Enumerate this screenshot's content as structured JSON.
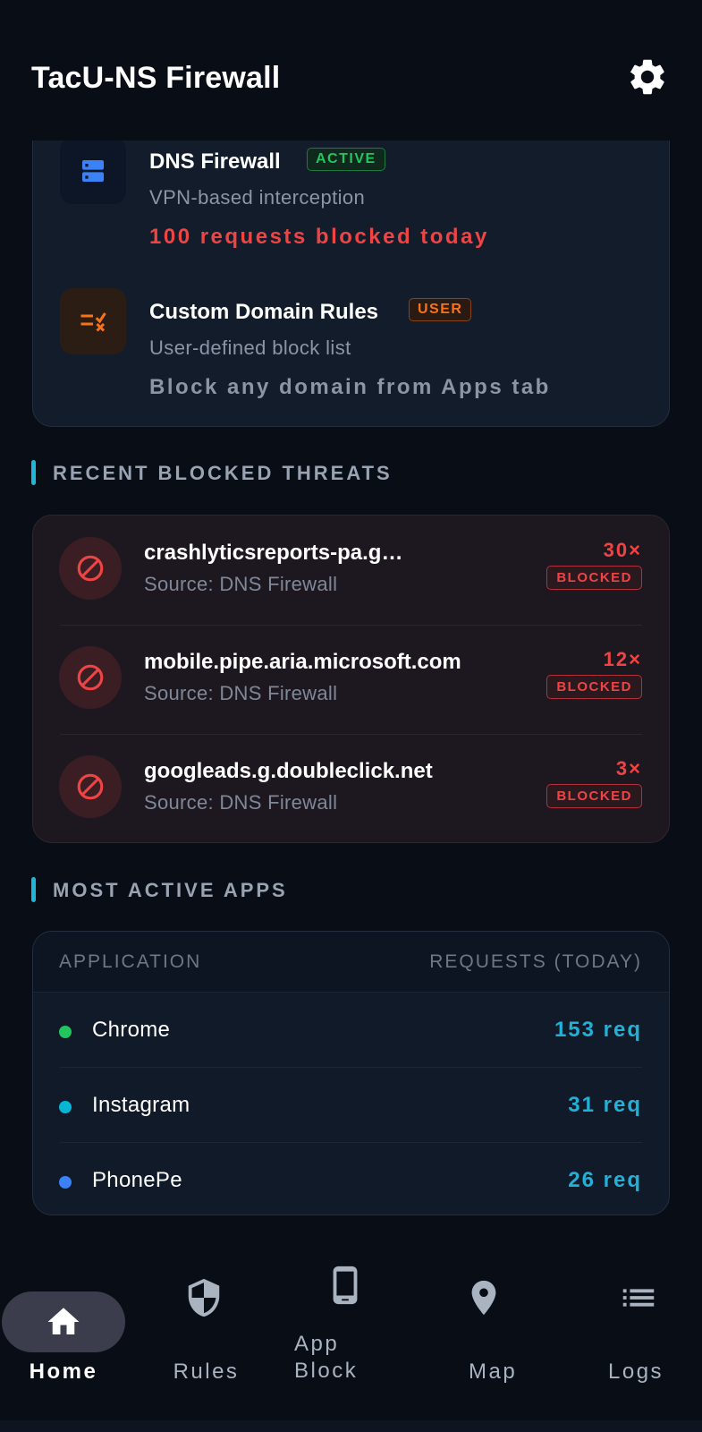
{
  "app": {
    "title": "TacU-NS Firewall"
  },
  "engines": [
    {
      "name": "DNS Firewall",
      "badge": "ACTIVE",
      "description": "VPN-based interception",
      "stat": "100 requests blocked today"
    },
    {
      "name": "Custom Domain Rules",
      "badge": "USER",
      "description": "User-defined block list",
      "stat": "Block any domain from Apps tab"
    }
  ],
  "threats": {
    "section_title": "RECENT BLOCKED THREATS",
    "items": [
      {
        "domain": "crashlyticsreports-pa.googleapis.com",
        "source": "Source: DNS Firewall",
        "count": "30×",
        "status": "BLOCKED"
      },
      {
        "domain": "mobile.pipe.aria.microsoft.com",
        "source": "Source: DNS Firewall",
        "count": "12×",
        "status": "BLOCKED"
      },
      {
        "domain": "googleads.g.doubleclick.net",
        "source": "Source: DNS Firewall",
        "count": "3×",
        "status": "BLOCKED"
      }
    ]
  },
  "apps": {
    "section_title": "MOST ACTIVE APPS",
    "col_application": "APPLICATION",
    "col_requests": "REQUESTS (TODAY)",
    "rows": [
      {
        "name": "Chrome",
        "requests": "153 req",
        "dot_color": "#22c55e"
      },
      {
        "name": "Instagram",
        "requests": "31 req",
        "dot_color": "#06b6d4"
      },
      {
        "name": "PhonePe",
        "requests": "26 req",
        "dot_color": "#3b82f6"
      }
    ]
  },
  "nav": {
    "items": [
      {
        "label": "Home",
        "icon": "home-icon",
        "active": true
      },
      {
        "label": "Rules",
        "icon": "shield-icon"
      },
      {
        "label": "App\nBlock",
        "icon": "phone-icon"
      },
      {
        "label": "Map",
        "icon": "location-pin-icon"
      },
      {
        "label": "Logs",
        "icon": "list-icon"
      }
    ]
  },
  "colors": {
    "accent": "#1fb6d8",
    "danger": "#ef4444",
    "active_badge": "#22c55e",
    "user_badge": "#f97316"
  }
}
